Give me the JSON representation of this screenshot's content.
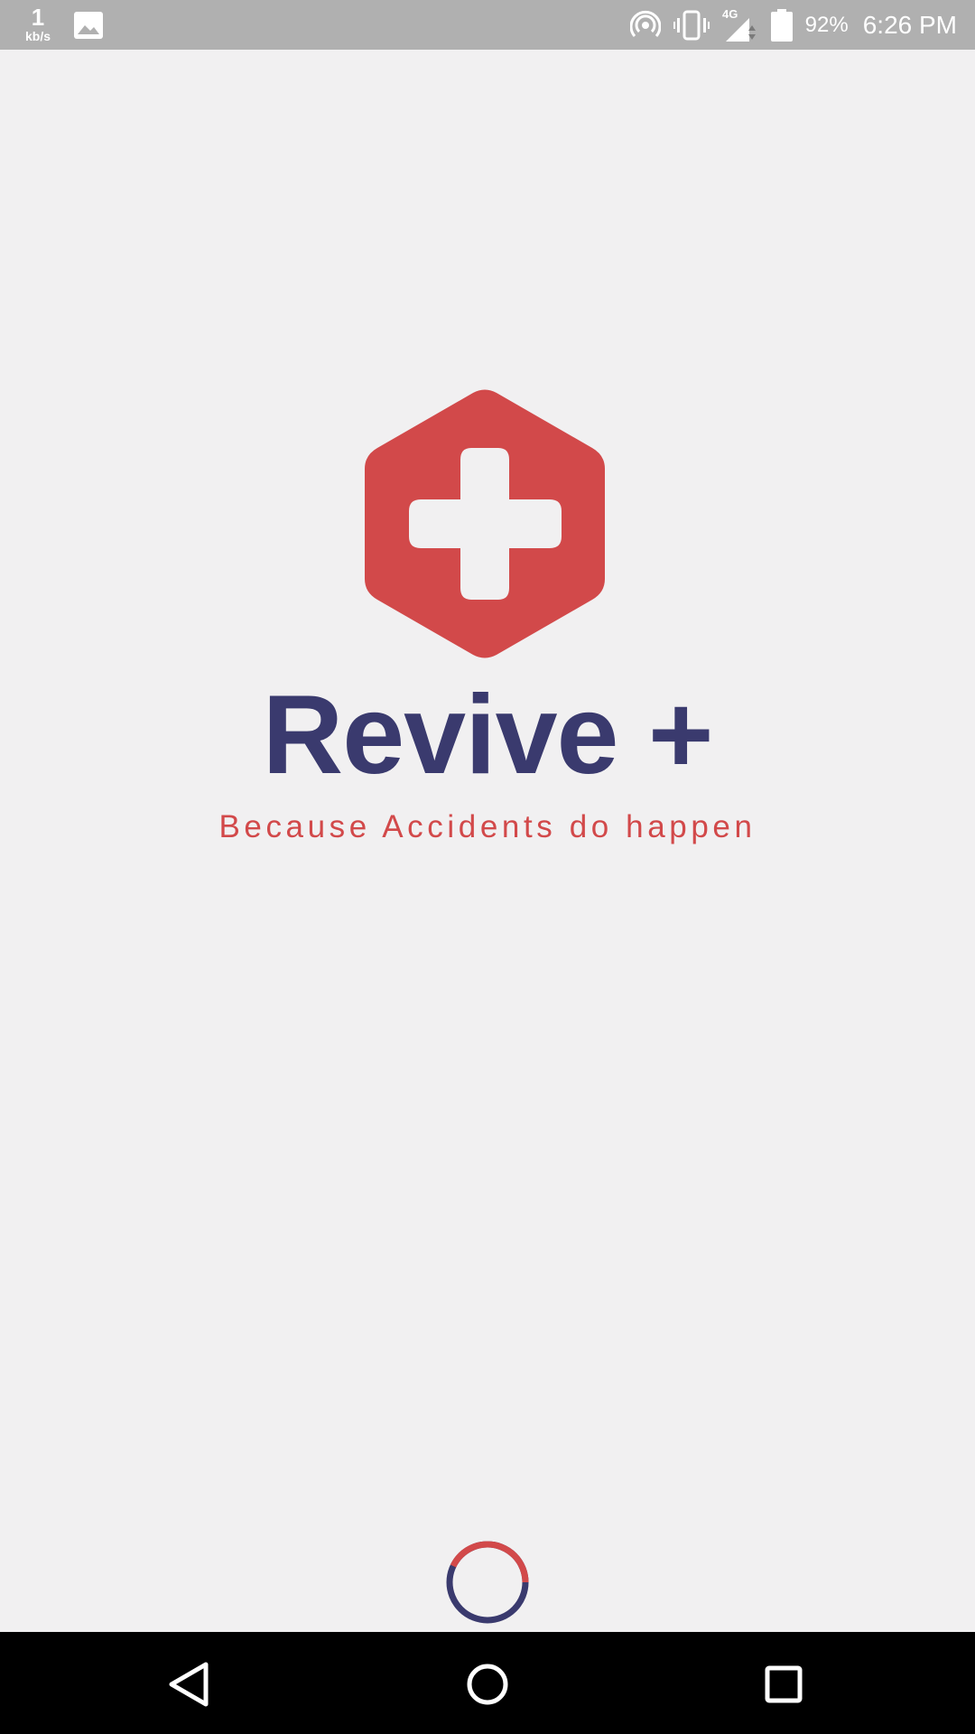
{
  "status_bar": {
    "net_speed_value": "1",
    "net_speed_unit": "kb/s",
    "network_type": "4G",
    "battery_percent": "92%",
    "time": "6:26 PM",
    "icons": [
      "gallery-icon",
      "hotspot-icon",
      "vibrate-icon",
      "signal-4g-icon",
      "battery-icon"
    ]
  },
  "app": {
    "name": "Revive +",
    "tagline": "Because Accidents do happen"
  },
  "colors": {
    "brand_red": "#d2494a",
    "brand_navy": "#3a3a6e",
    "background": "#f1f0f1"
  },
  "loading": {
    "icon": "loading-spinner"
  },
  "nav_bar": {
    "buttons": [
      "back-icon",
      "home-icon",
      "recents-icon"
    ]
  }
}
